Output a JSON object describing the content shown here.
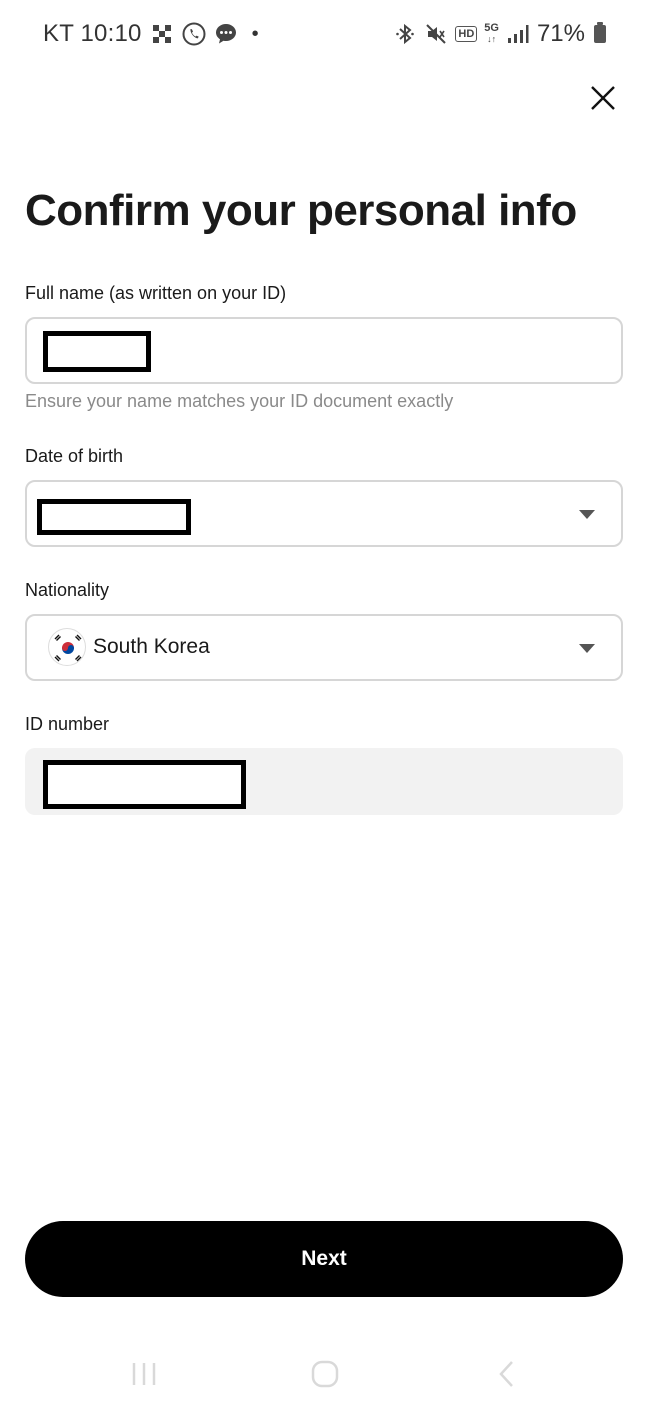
{
  "status_bar": {
    "carrier_time": "KT 10:10",
    "dot": "•",
    "battery_percent": "71%",
    "hd_label": "HD",
    "network_label": "5G",
    "icons": [
      "grid-icon",
      "phone-icon",
      "chat-icon",
      "bluetooth-icon",
      "mute-icon",
      "hd-icon",
      "5g-icon",
      "signal-icon",
      "battery-icon"
    ]
  },
  "header": {
    "close_icon": "close-icon"
  },
  "page": {
    "title": "Confirm your personal info"
  },
  "form": {
    "full_name": {
      "label": "Full name (as written on your ID)",
      "helper": "Ensure your name matches your ID document exactly"
    },
    "date_of_birth": {
      "label": "Date of birth"
    },
    "nationality": {
      "label": "Nationality",
      "value": "South Korea",
      "flag_icon": "south-korea-flag-icon"
    },
    "id_number": {
      "label": "ID number"
    }
  },
  "actions": {
    "next_label": "Next"
  },
  "nav_bar": {
    "icons": [
      "recents-icon",
      "home-icon",
      "back-icon"
    ]
  },
  "colors": {
    "primary_button": "#000000",
    "field_border": "#d6d6d6",
    "disabled_field_bg": "#f2f2f2",
    "helper_text": "#8a8a8a"
  }
}
